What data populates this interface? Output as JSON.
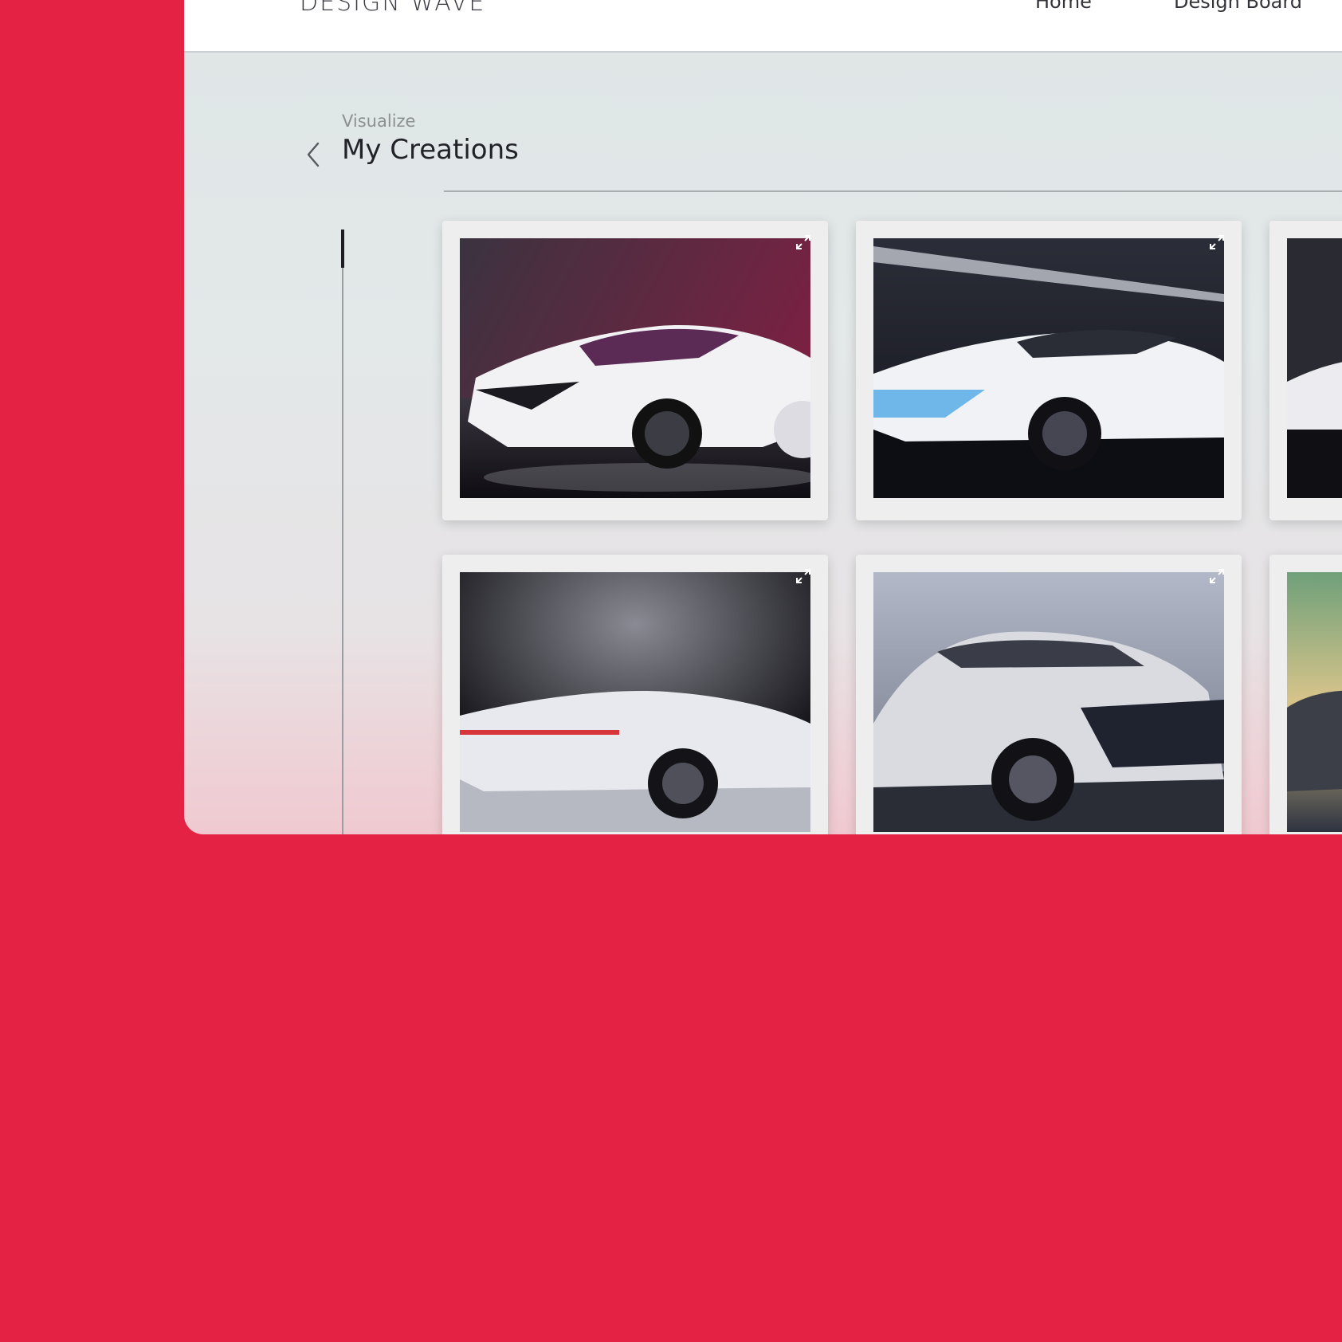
{
  "header": {
    "brand": "DESIGN WAVE",
    "nav": [
      {
        "label": "Home"
      },
      {
        "label": "Design Board"
      }
    ]
  },
  "page": {
    "breadcrumb": "Visualize",
    "title": "My Creations"
  },
  "gallery": {
    "cards": [
      {
        "scene": "purple-studio",
        "icon": "expand-icon"
      },
      {
        "scene": "blue-studio",
        "icon": "expand-icon"
      },
      {
        "scene": "dark-studio",
        "icon": "expand-icon"
      },
      {
        "scene": "black-studio",
        "icon": "expand-icon"
      },
      {
        "scene": "grey-studio",
        "icon": "expand-icon"
      },
      {
        "scene": "sunset-studio",
        "icon": "expand-icon"
      }
    ]
  },
  "colors": {
    "background": "#e42243",
    "card": "#eeeeee"
  }
}
